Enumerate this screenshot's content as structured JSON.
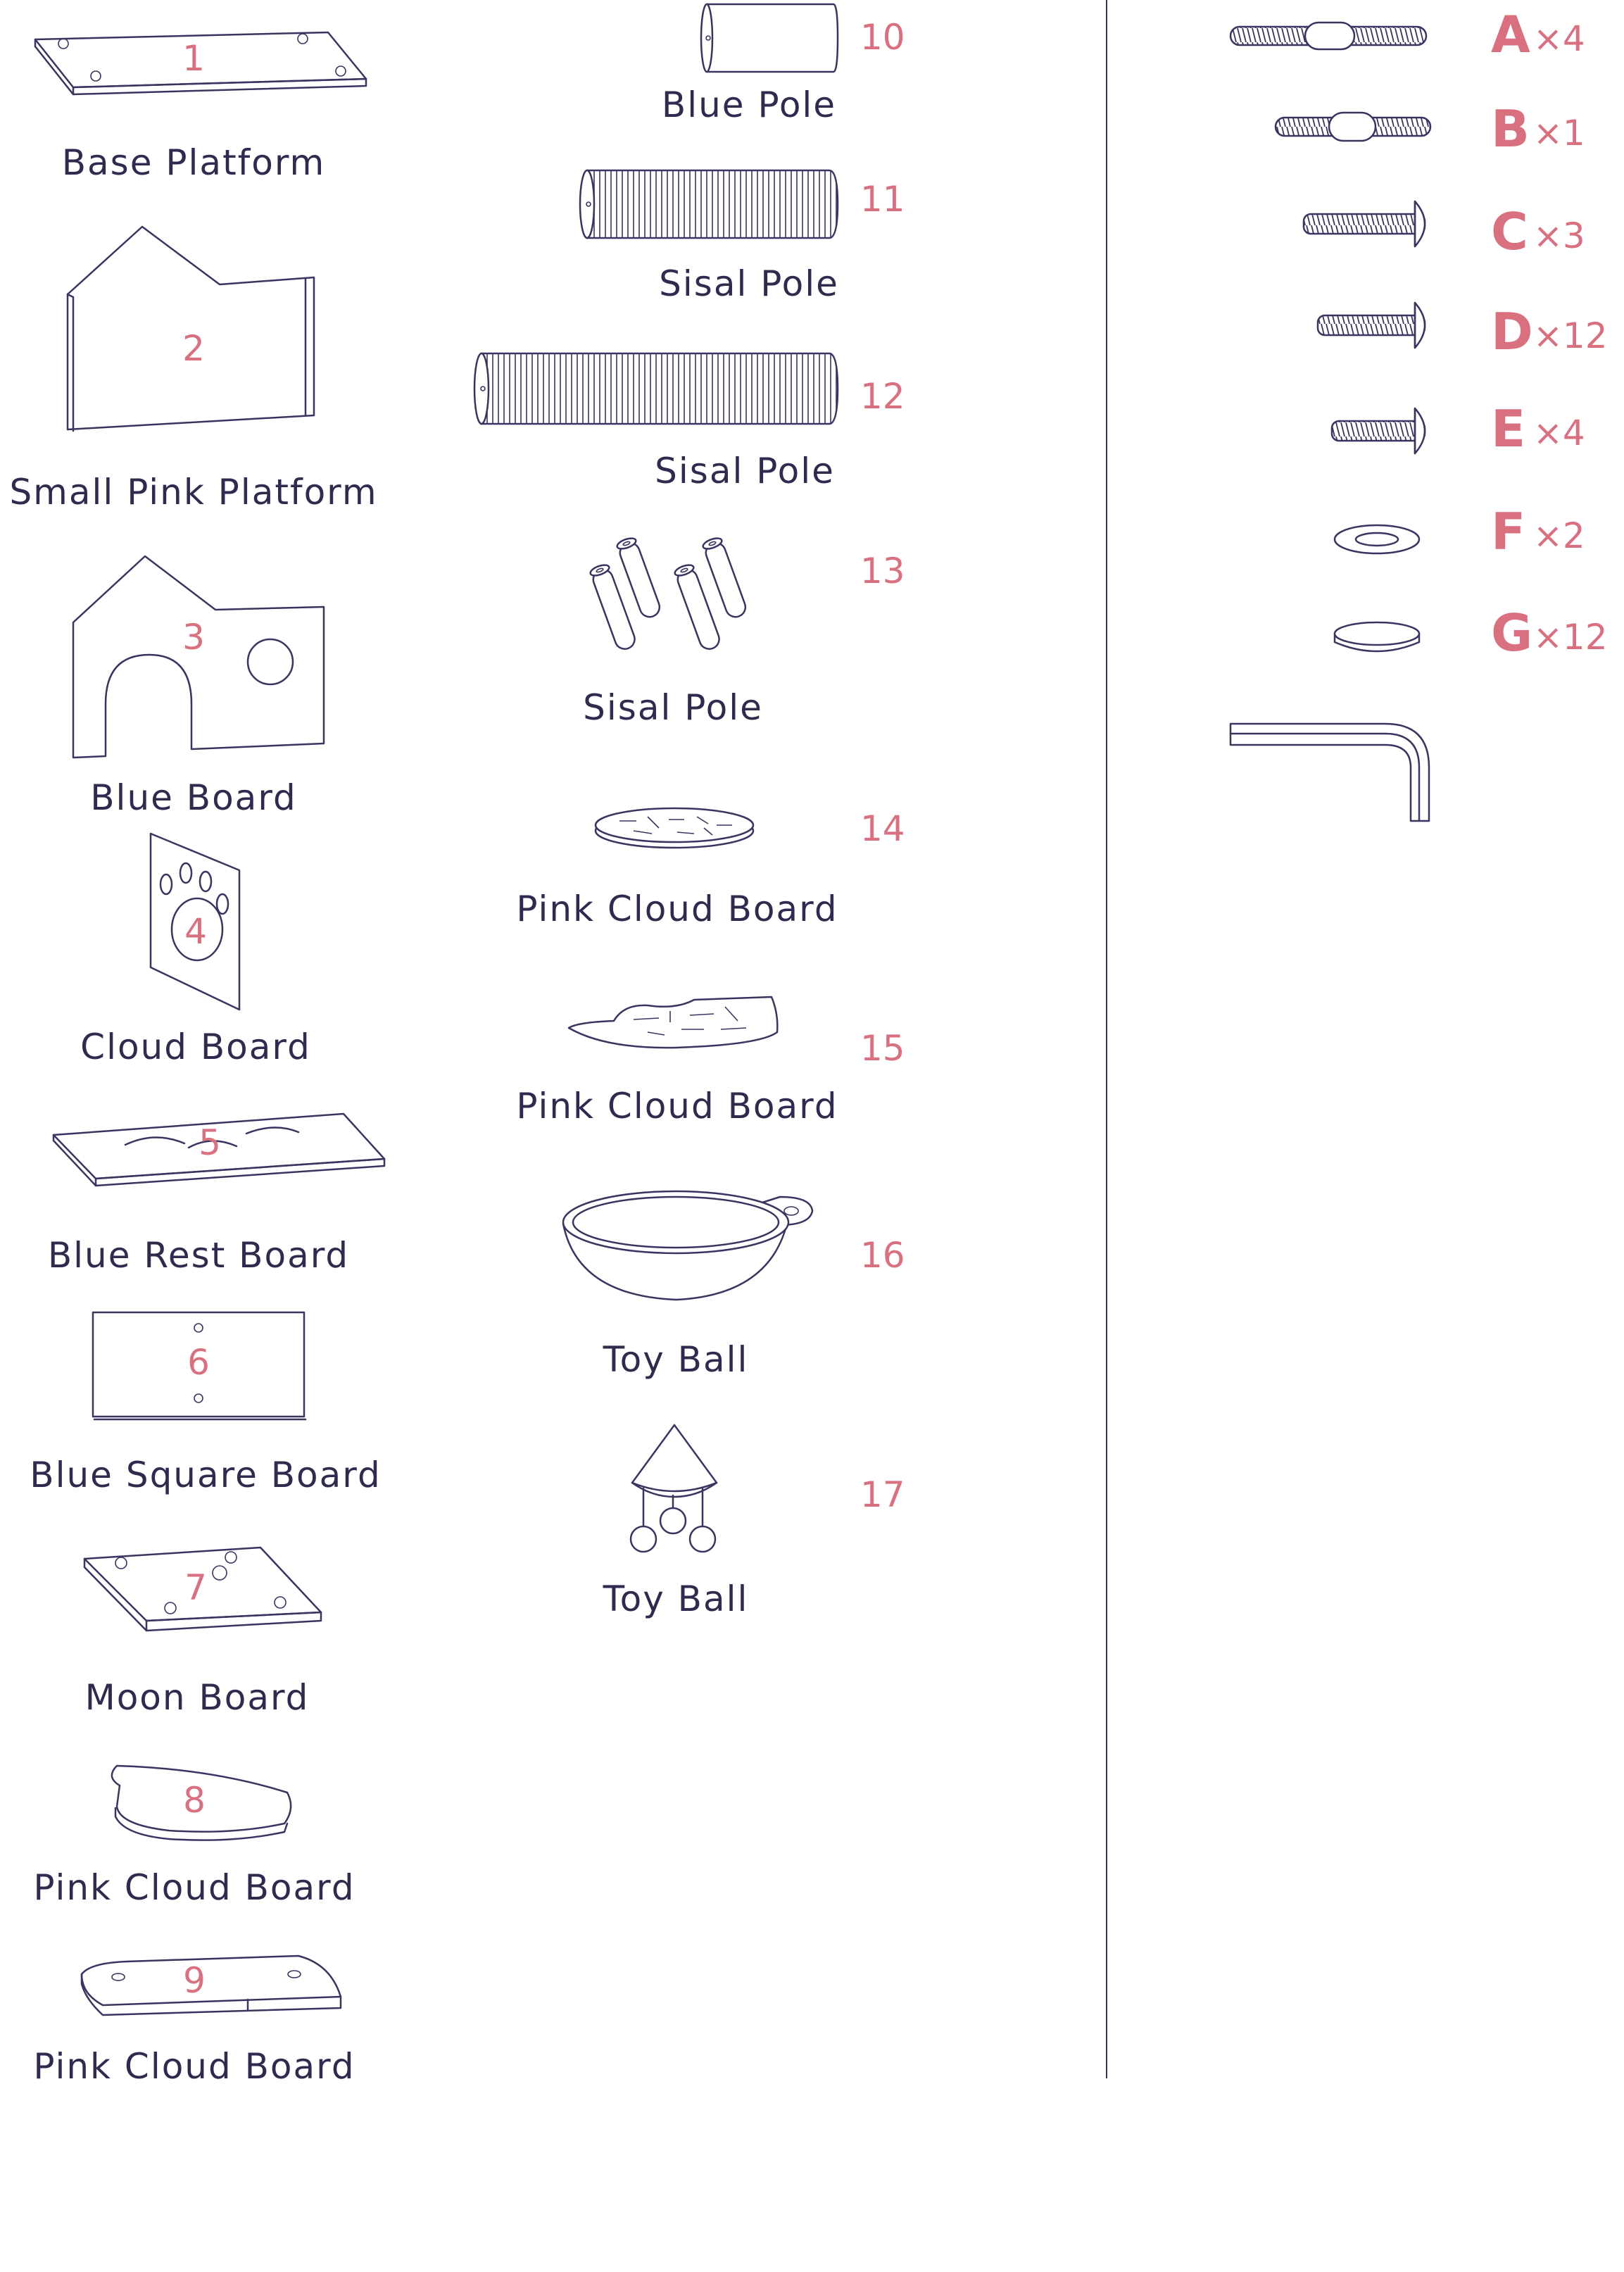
{
  "colors": {
    "line": "#3a3460",
    "label": "#2f2b4f",
    "accent": "#d9707f"
  },
  "parts": [
    {
      "number": "1",
      "name": "Base Platform"
    },
    {
      "number": "2",
      "name": "Small Pink Platform"
    },
    {
      "number": "3",
      "name": "Blue Board"
    },
    {
      "number": "4",
      "name": "Cloud Board"
    },
    {
      "number": "5",
      "name": "Blue Rest Board"
    },
    {
      "number": "6",
      "name": "Blue Square Board"
    },
    {
      "number": "7",
      "name": "Moon Board"
    },
    {
      "number": "8",
      "name": "Pink Cloud Board"
    },
    {
      "number": "9",
      "name": "Pink Cloud Board"
    },
    {
      "number": "10",
      "name": "Blue Pole"
    },
    {
      "number": "11",
      "name": "Sisal Pole"
    },
    {
      "number": "12",
      "name": "Sisal Pole"
    },
    {
      "number": "13",
      "name": "Sisal Pole"
    },
    {
      "number": "14",
      "name": "Pink Cloud Board"
    },
    {
      "number": "15",
      "name": "Pink Cloud Board"
    },
    {
      "number": "16",
      "name": "Toy Ball"
    },
    {
      "number": "17",
      "name": "Toy Ball"
    }
  ],
  "hardware": [
    {
      "letter": "A",
      "qty": "×4"
    },
    {
      "letter": "B",
      "qty": "×1"
    },
    {
      "letter": "C",
      "qty": "×3"
    },
    {
      "letter": "D",
      "qty": "×12"
    },
    {
      "letter": "E",
      "qty": "×4"
    },
    {
      "letter": "F",
      "qty": "×2"
    },
    {
      "letter": "G",
      "qty": "×12"
    }
  ]
}
